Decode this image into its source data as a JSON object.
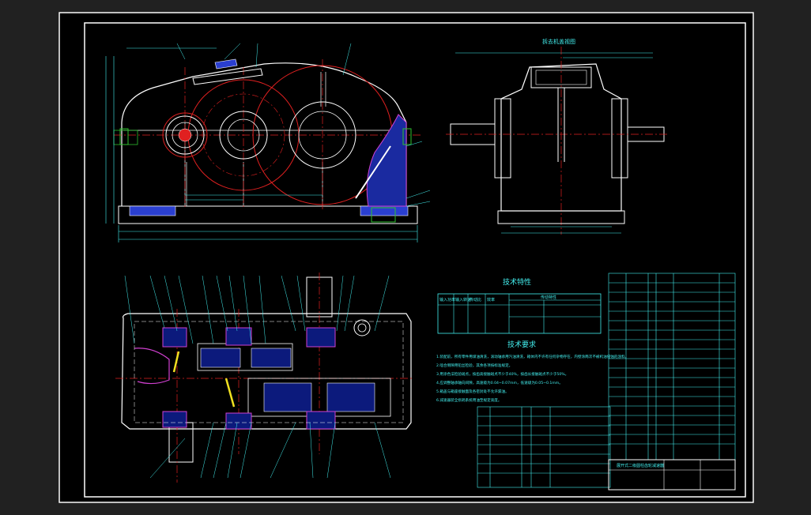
{
  "view_top": {
    "title": "拆去机盖视图"
  },
  "tech_char": {
    "title": "技术特性",
    "col1": "输入功率",
    "col2": "输入转速",
    "col3": "传动比",
    "col4": "效率",
    "header_right": "传动特性"
  },
  "tech_req": {
    "title": "技术要求",
    "lines": [
      "1.装配前，所有零件用煤油清洗，滚动轴承用汽油清洗，箱体内不许有任何杂物存在，内壁涂两次不被机油侵蚀的涂料。",
      "2.啮合侧隙用铅丝检验，其余各项按标准规定。",
      "3.用涂色法检验斑点，按齿高接触斑点不少于40%，按齿长接触斑点不少于50%。",
      "4.应调整轴承轴向间隙，高速级为0.04~0.07mm，低速级为0.05~0.1mm。",
      "5.箱盖与箱座接触面及各密封处不允许漏油。",
      "6.减速器装全损耗系统用油至规定高度。"
    ]
  },
  "title_block": {
    "name": "展开式二级圆柱齿轮减速器"
  }
}
